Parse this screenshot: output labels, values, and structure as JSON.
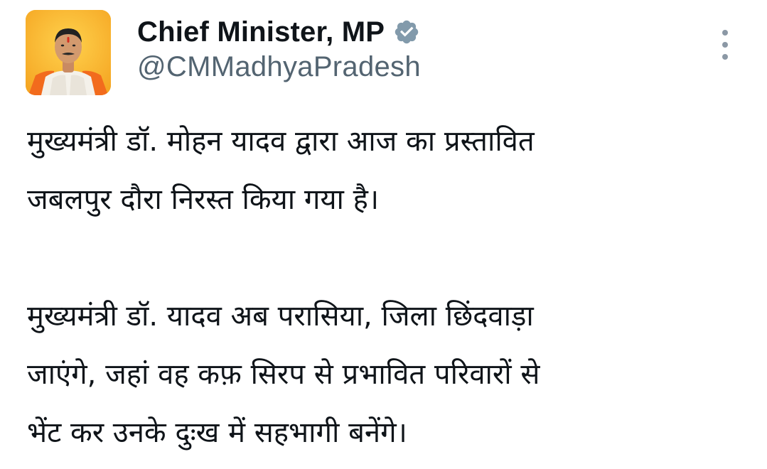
{
  "author": {
    "display_name": "Chief Minister, MP",
    "handle": "@CMMadhyaPradesh",
    "verified": true,
    "avatar_background": "#f8b21c"
  },
  "menu": {
    "icon": "more-vertical-icon"
  },
  "colors": {
    "text_primary": "#0f1419",
    "text_secondary": "#536471",
    "verified_badge": "#829aab"
  },
  "tweet": {
    "paragraph_1": [
      "मुख्यमंत्री डॉ. मोहन यादव  द्वारा आज का प्रस्तावित",
      "जबलपुर दौरा निरस्त किया गया है।"
    ],
    "paragraph_2": [
      "मुख्यमंत्री डॉ. यादव अब परासिया, जिला छिंदवाड़ा",
      "जाएंगे, जहां वह कफ़ सिरप से प्रभावित परिवारों से",
      "भेंट कर उनके दुःख में सहभागी बनेंगे।"
    ]
  }
}
